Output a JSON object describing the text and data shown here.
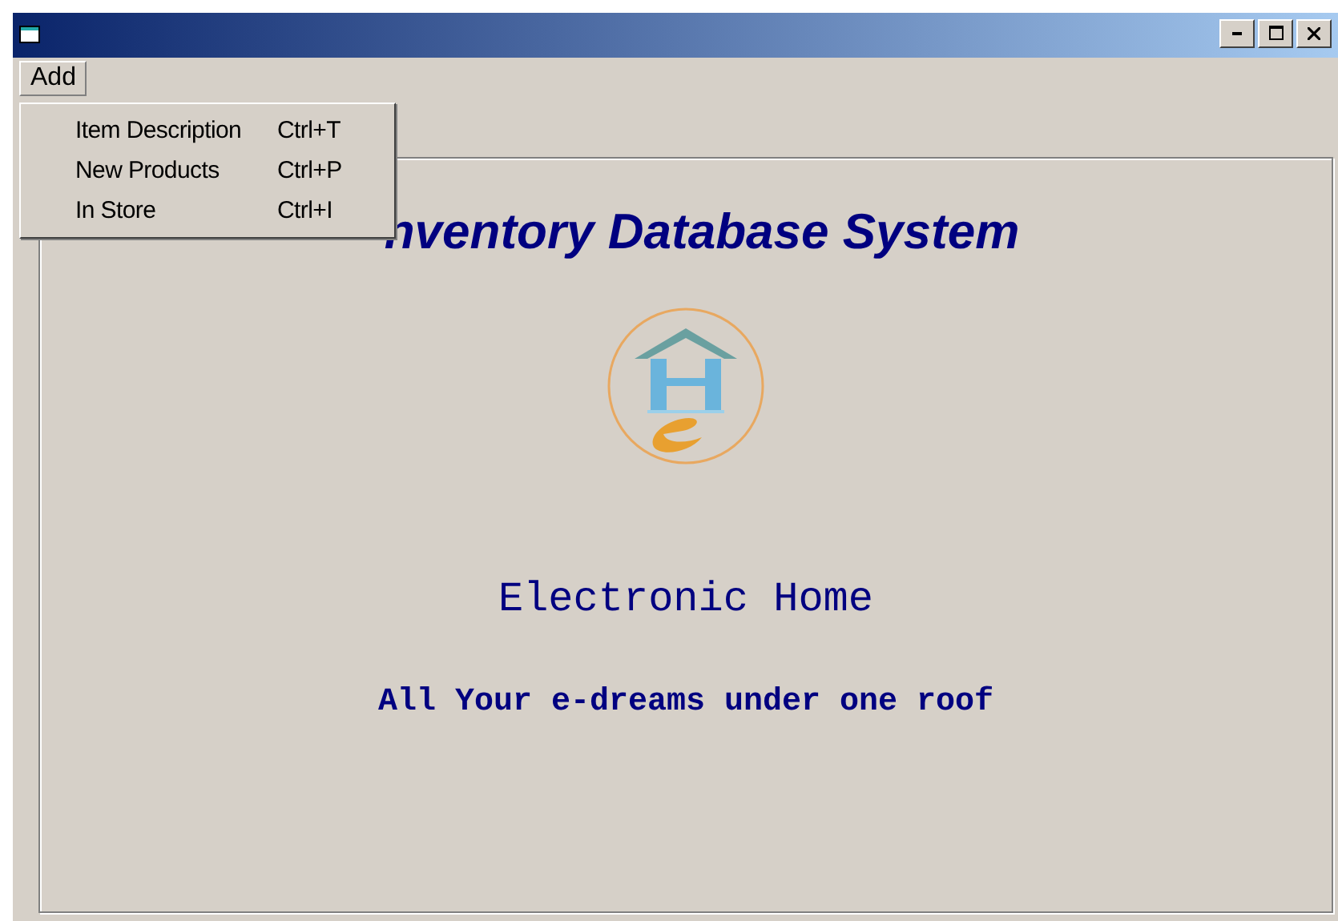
{
  "window": {
    "controls": [
      {
        "kind": "minimize"
      },
      {
        "kind": "maximize"
      },
      {
        "kind": "close"
      }
    ]
  },
  "menu_bar": [
    {
      "label": "Add",
      "selected": true
    }
  ],
  "dropdown": [
    {
      "label": "Item Description",
      "shortcut": "Ctrl+T"
    },
    {
      "label": "New Products",
      "shortcut": "Ctrl+P"
    },
    {
      "label": "In Store",
      "shortcut": "Ctrl+I"
    }
  ],
  "content": {
    "title": "nventory Database System",
    "heading": "Electronic Home",
    "tagline": "All Your e-dreams under one roof"
  }
}
